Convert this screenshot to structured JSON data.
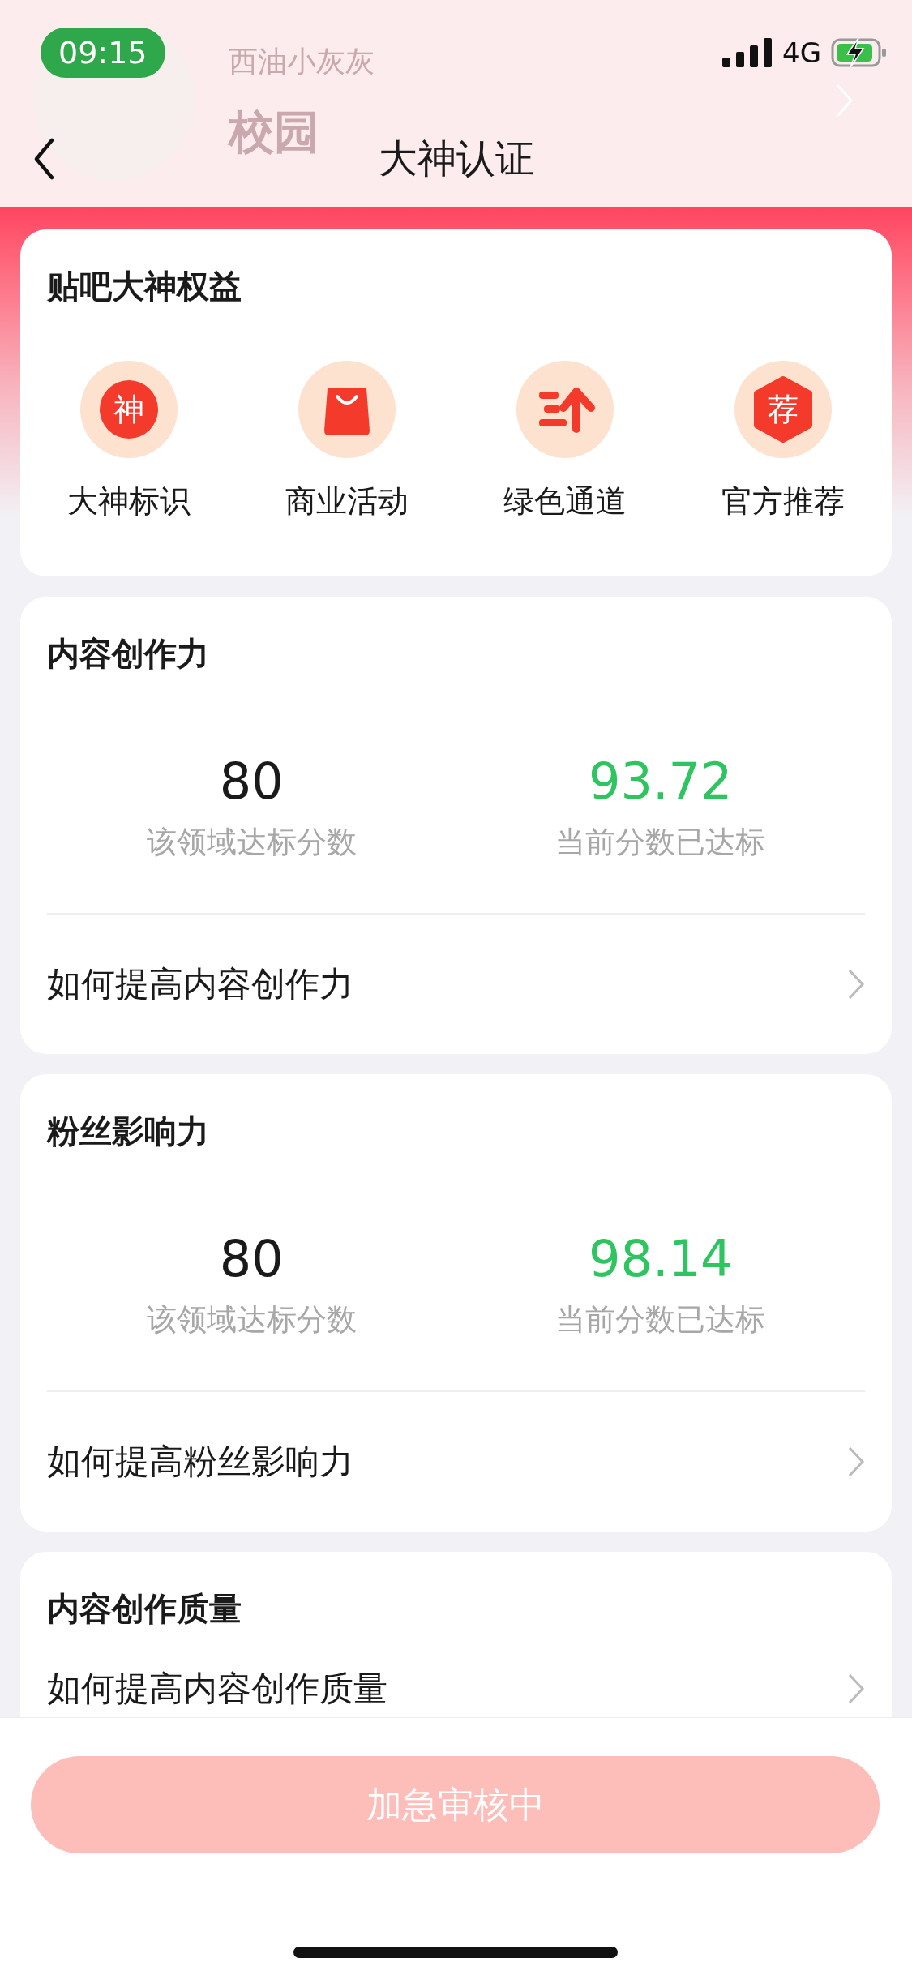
{
  "status_bar": {
    "time": "09:15",
    "network": "4G",
    "charging": true
  },
  "background_profile": {
    "name": "西油小灰灰",
    "group": "校园"
  },
  "nav": {
    "title": "大神认证"
  },
  "benefits": {
    "title": "贴吧大神权益",
    "items": [
      {
        "label": "大神标识",
        "kind": "seal",
        "glyph": "神"
      },
      {
        "label": "商业活动",
        "kind": "bag"
      },
      {
        "label": "绿色通道",
        "kind": "fast"
      },
      {
        "label": "官方推荐",
        "kind": "hexagon",
        "glyph": "荐"
      }
    ]
  },
  "sections": [
    {
      "title": "内容创作力",
      "target_score": "80",
      "target_label": "该领域达标分数",
      "current_score": "93.72",
      "current_label": "当前分数已达标",
      "met": true,
      "link": "如何提高内容创作力"
    },
    {
      "title": "粉丝影响力",
      "target_score": "80",
      "target_label": "该领域达标分数",
      "current_score": "98.14",
      "current_label": "当前分数已达标",
      "met": true,
      "link": "如何提高粉丝影响力"
    },
    {
      "title": "内容创作质量",
      "link": "如何提高内容创作质量"
    }
  ],
  "action_button": {
    "label": "加急审核中",
    "disabled": true
  }
}
